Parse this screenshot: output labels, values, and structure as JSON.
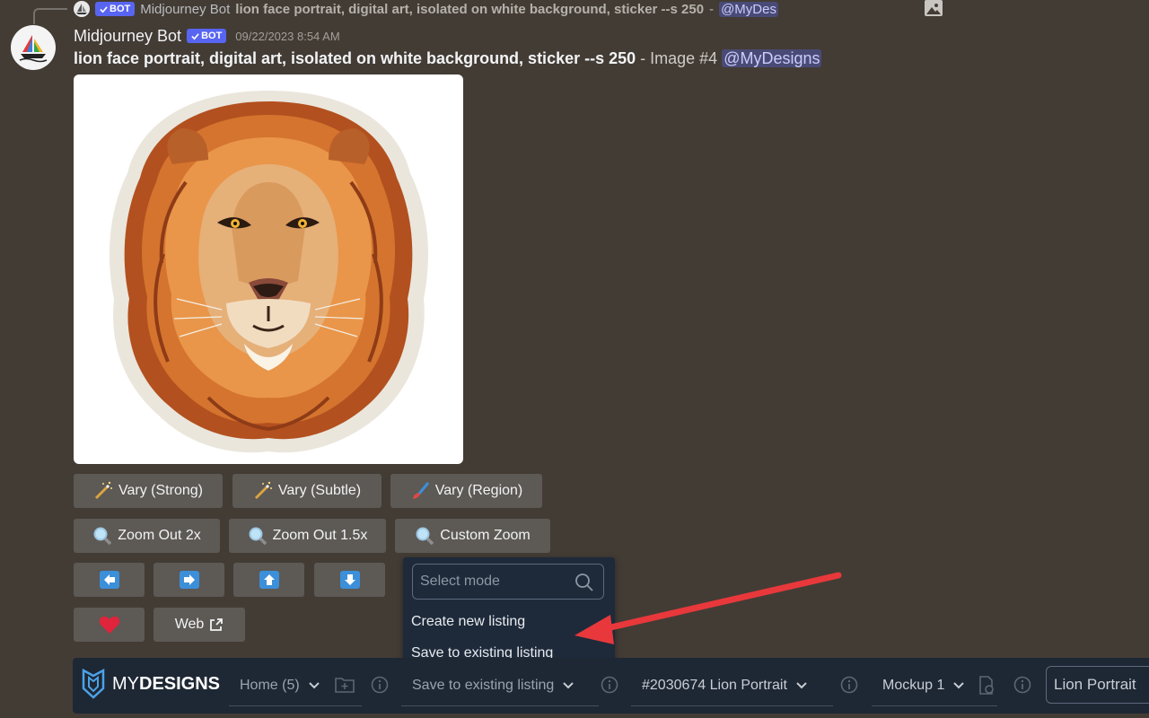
{
  "reply": {
    "author": "Midjourney Bot",
    "badge": "BOT",
    "text": "lion face portrait, digital art, isolated on white background, sticker --s 250",
    "dash": "-",
    "mention": "@MyDes"
  },
  "message": {
    "author": "Midjourney Bot",
    "badge": "BOT",
    "timestamp": "09/22/2023 8:54 AM",
    "prompt": "lion face portrait, digital art, isolated on white background, sticker --s 250",
    "suffix": " - Image #4 ",
    "mention": "@MyDesigns"
  },
  "buttons": {
    "vary_strong": "Vary (Strong)",
    "vary_subtle": "Vary (Subtle)",
    "vary_region": "Vary (Region)",
    "zoom_out_2x": "Zoom Out 2x",
    "zoom_out_15x": "Zoom Out 1.5x",
    "custom_zoom": "Custom Zoom",
    "web": "Web"
  },
  "dropdown": {
    "placeholder": "Select mode",
    "items": [
      "Create new listing",
      "Save to existing listing"
    ]
  },
  "toolbar": {
    "logo_my": "MY",
    "logo_designs": "DESIGNS",
    "home": "Home (5)",
    "save_mode": "Save to existing listing",
    "listing": "#2030674 Lion Portrait",
    "mockup": "Mockup 1",
    "title_value": "Lion Portrait"
  },
  "colors": {
    "background": "#433c35",
    "bot_badge": "#5865f2",
    "toolbar": "#1e2734",
    "dropdown": "#1e2a3a",
    "annotation": "#e8383b"
  }
}
